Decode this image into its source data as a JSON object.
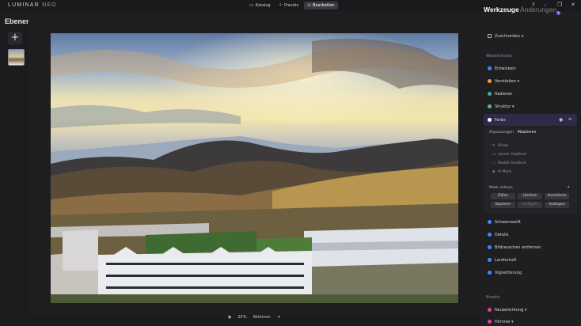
{
  "app": {
    "logo_main": "LUMINAR",
    "logo_sub": "NEO"
  },
  "nav": {
    "katalog": "Katalog",
    "presets": "Presets",
    "bearbeiten": "Bearbeiten"
  },
  "left": {
    "title": "Ebenen",
    "add_label": "+"
  },
  "bottom": {
    "zoom": "25%",
    "aktionen": "Aktionen"
  },
  "right": {
    "tab_werkzeuge": "Werkzeuge",
    "tab_aenderungen": "Änderungen",
    "badge": "1",
    "zuschneiden": "Zuschneiden",
    "section_wesentliches": "Wesentliches",
    "entwickeln": "Entwickeln",
    "verstaerken": "Verstärken",
    "radieren": "Radieren",
    "struktur": "Struktur",
    "farbe": "Farbe",
    "subtab_anpassungen": "Anpassungen",
    "subtab_maskieren": "Maskieren",
    "masks": [
      "Pinsel",
      "Linear Gradient",
      "Radial Gradient",
      "AI Mask"
    ],
    "mask_actions_title": "Mask actions",
    "actions": [
      "Füllen",
      "Löschen",
      "Invertieren",
      "Kopieren",
      "Einfügen",
      "Anzeigen"
    ],
    "schwarzweiss": "Schwarzweiß",
    "details": "Details",
    "bildrauschen": "Bildrauschen entfernen",
    "landschaft": "Landschaft",
    "vignettierung": "Vignettierung",
    "section_kreativ": "Kreativ",
    "neubelichtung": "Neubelichtung",
    "himmel": "Himmel"
  },
  "colors": {
    "accent_purple": "#7a5cff",
    "farbe_highlight": "#2e2b4a"
  }
}
